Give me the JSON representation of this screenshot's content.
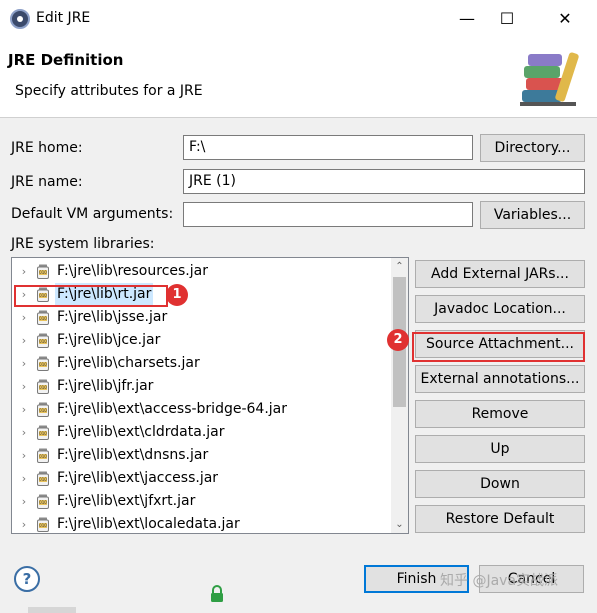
{
  "window": {
    "title": "Edit JRE",
    "minimize": "—",
    "maximize": "☐",
    "close": "✕"
  },
  "header": {
    "title": "JRE Definition",
    "description": "Specify attributes for a JRE"
  },
  "form": {
    "jre_home_label": "JRE home:",
    "jre_home_value": "F:\\",
    "directory_button": "Directory...",
    "jre_name_label": "JRE name:",
    "jre_name_value": "JRE (1)",
    "vm_args_label": "Default VM arguments:",
    "vm_args_value": "",
    "variables_button": "Variables...",
    "libraries_label": "JRE system libraries:"
  },
  "libraries": [
    "F:\\jre\\lib\\resources.jar",
    "F:\\jre\\lib\\rt.jar",
    "F:\\jre\\lib\\jsse.jar",
    "F:\\jre\\lib\\jce.jar",
    "F:\\jre\\lib\\charsets.jar",
    "F:\\jre\\lib\\jfr.jar",
    "F:\\jre\\lib\\ext\\access-bridge-64.jar",
    "F:\\jre\\lib\\ext\\cldrdata.jar",
    "F:\\jre\\lib\\ext\\dnsns.jar",
    "F:\\jre\\lib\\ext\\jaccess.jar",
    "F:\\jre\\lib\\ext\\jfxrt.jar",
    "F:\\jre\\lib\\ext\\localedata.jar"
  ],
  "side_buttons": {
    "add_external_jars": "Add External JARs...",
    "javadoc_location": "Javadoc Location...",
    "source_attachment": "Source Attachment...",
    "external_annotations": "External annotations...",
    "remove": "Remove",
    "up": "Up",
    "down": "Down",
    "restore_default": "Restore Default"
  },
  "annotations": {
    "marker_1": "1",
    "marker_2": "2",
    "color": "#e03131"
  },
  "footer": {
    "help": "?",
    "finish": "Finish",
    "cancel": "Cancel",
    "watermark": "知乎 @Java实战派"
  }
}
